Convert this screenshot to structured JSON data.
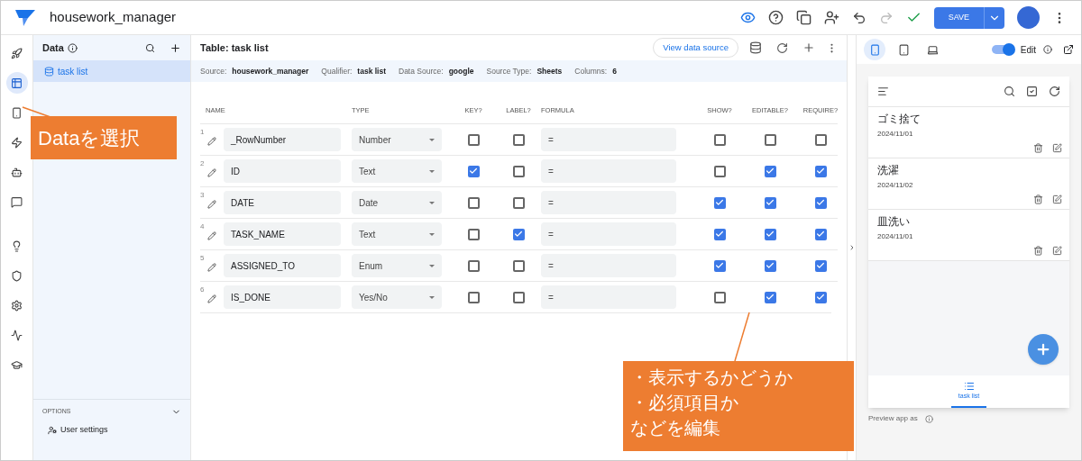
{
  "app": {
    "title": "housework_manager",
    "save_label": "SAVE"
  },
  "rail": [
    {
      "kind": "rocket",
      "selected": false
    },
    {
      "kind": "data",
      "selected": true
    },
    {
      "kind": "phone",
      "selected": false
    },
    {
      "kind": "bolt",
      "selected": false
    },
    {
      "kind": "bot",
      "selected": false
    },
    {
      "kind": "chat",
      "selected": false
    },
    {
      "kind": "bulb",
      "selected": false
    },
    {
      "kind": "shield",
      "selected": false
    },
    {
      "kind": "gear",
      "selected": false
    },
    {
      "kind": "monitor",
      "selected": false
    },
    {
      "kind": "cap",
      "selected": false
    }
  ],
  "data_panel": {
    "title": "Data",
    "items": [
      {
        "label": "task list",
        "selected": true
      }
    ],
    "options_title": "OPTIONS",
    "options_items": [
      "User settings"
    ]
  },
  "table": {
    "title": "Table: task list",
    "view_button": "View data source",
    "meta": [
      {
        "label": "Source:",
        "value": "housework_manager"
      },
      {
        "label": "Qualifier:",
        "value": "task list"
      },
      {
        "label": "Data Source:",
        "value": "google"
      },
      {
        "label": "Source Type:",
        "value": "Sheets"
      },
      {
        "label": "Columns:",
        "value": "6"
      }
    ],
    "columns": [
      "NAME",
      "TYPE",
      "KEY?",
      "LABEL?",
      "FORMULA",
      "SHOW?",
      "EDITABLE?",
      "REQUIRE?"
    ],
    "rows": [
      {
        "number": "1",
        "name": "_RowNumber",
        "type": "Number",
        "key": false,
        "label": false,
        "formula": "=",
        "show": false,
        "editable": false,
        "require": false
      },
      {
        "number": "2",
        "name": "ID",
        "type": "Text",
        "key": true,
        "label": false,
        "formula": "=",
        "show": false,
        "editable": true,
        "require": true
      },
      {
        "number": "3",
        "name": "DATE",
        "type": "Date",
        "key": false,
        "label": false,
        "formula": "=",
        "show": true,
        "editable": true,
        "require": true
      },
      {
        "number": "4",
        "name": "TASK_NAME",
        "type": "Text",
        "key": false,
        "label": true,
        "formula": "=",
        "show": true,
        "editable": true,
        "require": true
      },
      {
        "number": "5",
        "name": "ASSIGNED_TO",
        "type": "Enum",
        "key": false,
        "label": false,
        "formula": "=",
        "show": true,
        "editable": true,
        "require": true
      },
      {
        "number": "6",
        "name": "IS_DONE",
        "type": "Yes/No",
        "key": false,
        "label": false,
        "formula": "=",
        "show": false,
        "editable": true,
        "require": true
      }
    ]
  },
  "preview": {
    "devices": [
      {
        "kind": "phone",
        "selected": true
      },
      {
        "kind": "tablet",
        "selected": false
      },
      {
        "kind": "laptop",
        "selected": false
      }
    ],
    "edit_on": true,
    "edit_label": "Edit",
    "items": [
      {
        "title": "ゴミ捨て",
        "date": "2024/11/01"
      },
      {
        "title": "洗濯",
        "date": "2024/11/02"
      },
      {
        "title": "皿洗い",
        "date": "2024/11/01"
      }
    ],
    "nav_label": "task list",
    "footer": "Preview app as"
  },
  "annotations": [
    {
      "lines": [
        "Dataを選択"
      ]
    },
    {
      "lines": [
        "・表示するかどうか",
        "・必須項目か",
        "などを編集"
      ]
    }
  ]
}
